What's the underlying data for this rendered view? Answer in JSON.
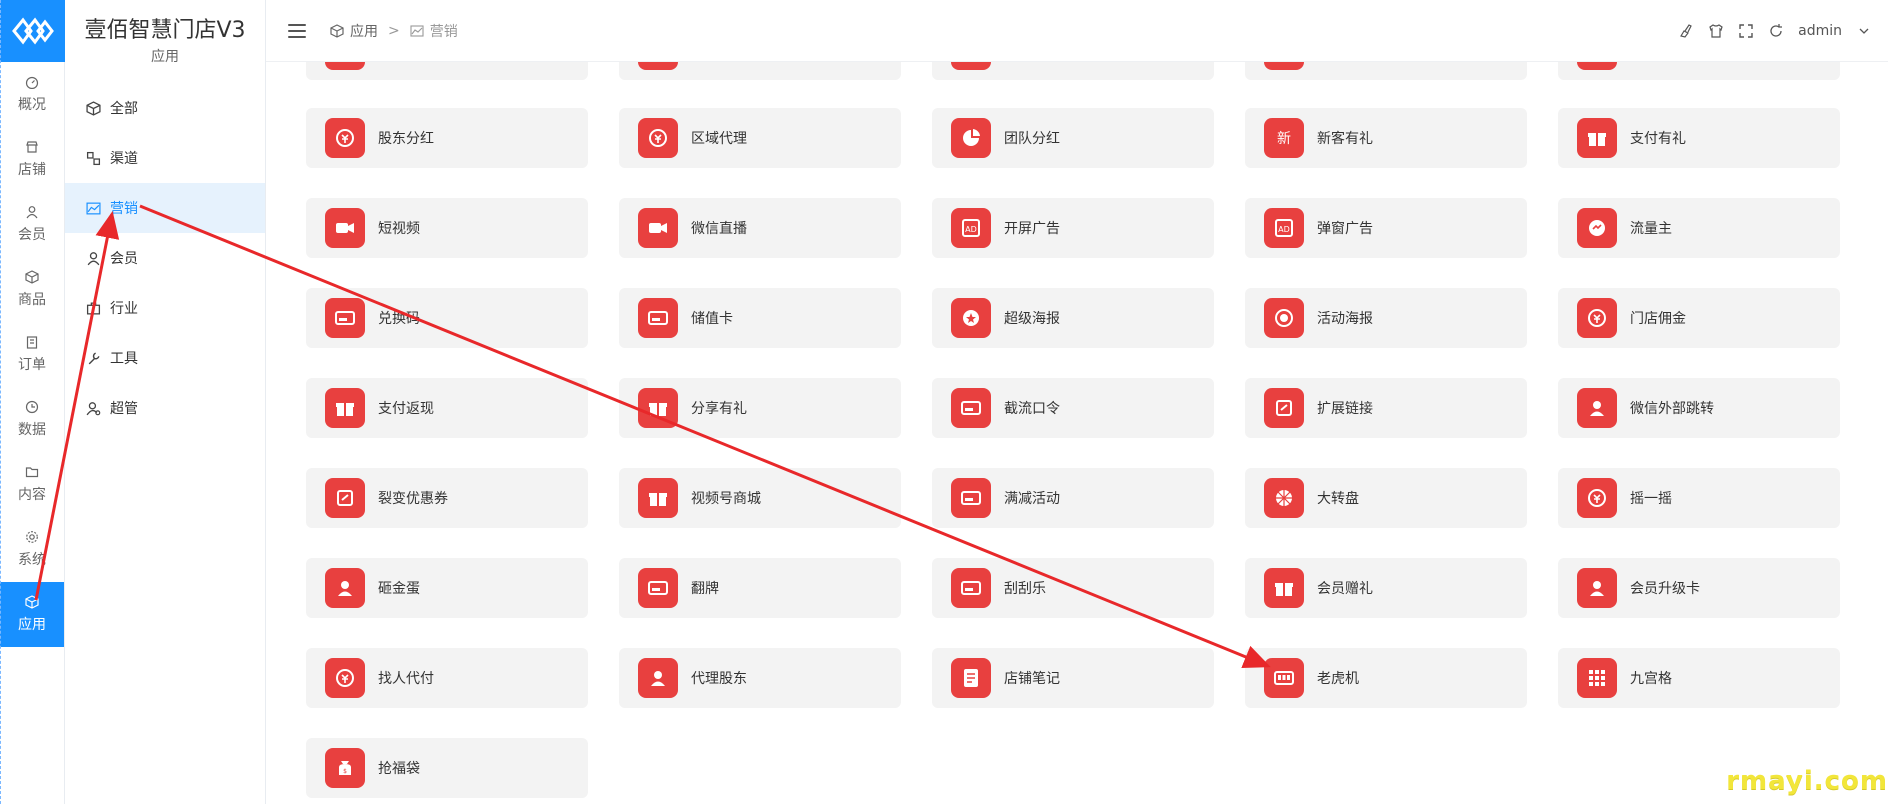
{
  "brand": {
    "title": "壹佰智慧门店V3",
    "subtitle": "应用"
  },
  "rail": [
    {
      "label": "概况",
      "icon": "dashboard-icon"
    },
    {
      "label": "店铺",
      "icon": "store-icon"
    },
    {
      "label": "会员",
      "icon": "user-icon"
    },
    {
      "label": "商品",
      "icon": "box-icon"
    },
    {
      "label": "订单",
      "icon": "clipboard-icon"
    },
    {
      "label": "数据",
      "icon": "clock-icon"
    },
    {
      "label": "内容",
      "icon": "folder-icon"
    },
    {
      "label": "系统",
      "icon": "gear-icon"
    },
    {
      "label": "应用",
      "icon": "cube-icon"
    }
  ],
  "submenu": [
    {
      "label": "全部",
      "icon": "cube-icon"
    },
    {
      "label": "渠道",
      "icon": "channel-icon"
    },
    {
      "label": "营销",
      "icon": "chart-line-icon"
    },
    {
      "label": "会员",
      "icon": "user-icon"
    },
    {
      "label": "行业",
      "icon": "briefcase-icon"
    },
    {
      "label": "工具",
      "icon": "wrench-icon"
    },
    {
      "label": "超管",
      "icon": "admin-icon"
    }
  ],
  "breadcrumb": {
    "first": "应用",
    "separator": ">",
    "second": "营销"
  },
  "header": {
    "user": "admin"
  },
  "apps": [
    "股东分红",
    "区域代理",
    "团队分红",
    "新客有礼",
    "支付有礼",
    "短视频",
    "微信直播",
    "开屏广告",
    "弹窗广告",
    "流量主",
    "兑换码",
    "储值卡",
    "超级海报",
    "活动海报",
    "门店佣金",
    "支付返现",
    "分享有礼",
    "截流口令",
    "扩展链接",
    "微信外部跳转",
    "裂变优惠券",
    "视频号商城",
    "满减活动",
    "大转盘",
    "摇一摇",
    "砸金蛋",
    "翻牌",
    "刮刮乐",
    "会员赠礼",
    "会员升级卡",
    "找人代付",
    "代理股东",
    "店铺笔记",
    "老虎机",
    "九宫格",
    "抢福袋"
  ],
  "watermark": "rmayi.com",
  "colors": {
    "accent": "#1890ff",
    "app_icon": "#e8403f",
    "arrow": "#e8282a"
  }
}
